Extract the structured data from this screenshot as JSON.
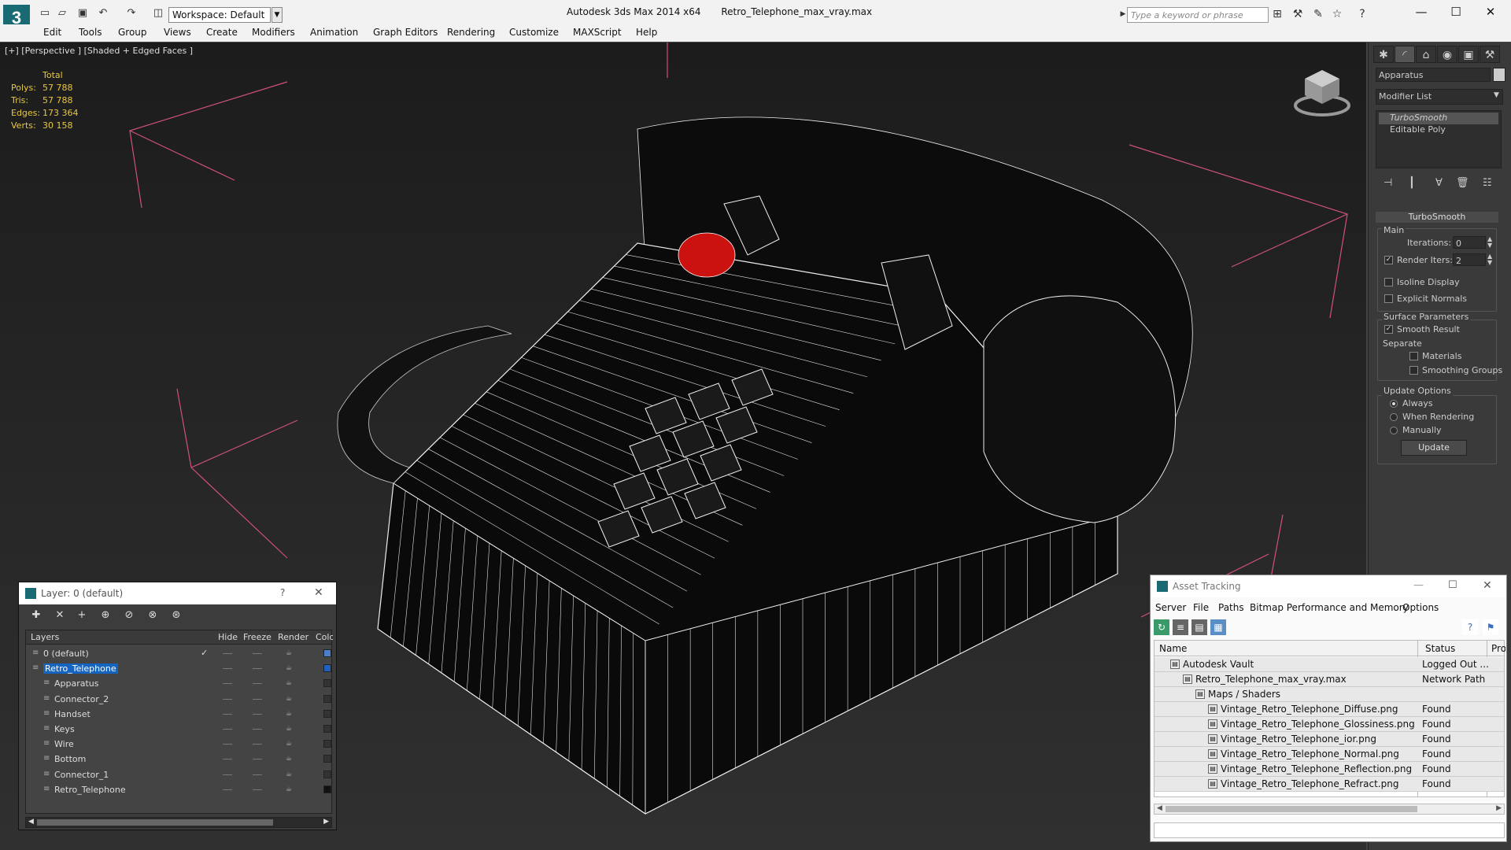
{
  "app": {
    "title": "Autodesk 3ds Max  2014 x64",
    "file": "Retro_Telephone_max_vray.max",
    "logo": "3",
    "workspace": "Workspace: Default",
    "search_placeholder": "Type a keyword or phrase"
  },
  "menu": [
    "Edit",
    "Tools",
    "Group",
    "Views",
    "Create",
    "Modifiers",
    "Animation",
    "Graph Editors",
    "Rendering",
    "Customize",
    "MAXScript",
    "Help"
  ],
  "viewport": {
    "label": "[+] [Perspective ] [Shaded + Edged Faces ]",
    "stats": {
      "header": "Total",
      "rows": [
        {
          "k": "Polys:",
          "v": "57 788"
        },
        {
          "k": "Tris:",
          "v": "57 788"
        },
        {
          "k": "Edges:",
          "v": "173 364"
        },
        {
          "k": "Verts:",
          "v": "30 158"
        }
      ]
    }
  },
  "command_panel": {
    "object_name": "Apparatus",
    "modifier_list": "Modifier List",
    "stack": [
      "TurboSmooth",
      "Editable Poly"
    ],
    "rollout_title": "TurboSmooth",
    "main_label": "Main",
    "iterations_label": "Iterations:",
    "iterations_value": "0",
    "render_iters_label": "Render Iters:",
    "render_iters_value": "2",
    "isoline_label": "Isoline Display",
    "explicit_normals_label": "Explicit Normals",
    "surface_params_label": "Surface Parameters",
    "smooth_result_label": "Smooth Result",
    "separate_label": "Separate",
    "materials_label": "Materials",
    "smoothing_groups_label": "Smoothing Groups",
    "update_options_label": "Update Options",
    "always_label": "Always",
    "when_rendering_label": "When Rendering",
    "manually_label": "Manually",
    "update_button": "Update"
  },
  "layer_window": {
    "title": "Layer: 0 (default)",
    "help": "?",
    "close": "✕",
    "columns": [
      "Layers",
      "Hide",
      "Freeze",
      "Render",
      "Color"
    ],
    "rows": [
      {
        "name": "0 (default)",
        "indent": 0,
        "check": "✓",
        "color": "#4a7fd0"
      },
      {
        "name": "Retro_Telephone",
        "indent": 0,
        "selected": true,
        "color": "#2060c0"
      },
      {
        "name": "Apparatus",
        "indent": 1,
        "color": "#333333"
      },
      {
        "name": "Connector_2",
        "indent": 1,
        "color": "#333333"
      },
      {
        "name": "Handset",
        "indent": 1,
        "color": "#333333"
      },
      {
        "name": "Keys",
        "indent": 1,
        "color": "#333333"
      },
      {
        "name": "Wire",
        "indent": 1,
        "color": "#333333"
      },
      {
        "name": "Bottom",
        "indent": 1,
        "color": "#333333"
      },
      {
        "name": "Connector_1",
        "indent": 1,
        "color": "#333333"
      },
      {
        "name": "Retro_Telephone",
        "indent": 1,
        "color": "#111111"
      }
    ]
  },
  "asset_window": {
    "title": "Asset Tracking",
    "menu": [
      "Server",
      "File",
      "Paths",
      "Bitmap Performance and Memory",
      "Options"
    ],
    "columns": [
      "Name",
      "Status",
      "Pro"
    ],
    "rows": [
      {
        "name": "Autodesk Vault",
        "status": "Logged Out ...",
        "indent": 0
      },
      {
        "name": "Retro_Telephone_max_vray.max",
        "status": "Network Path",
        "indent": 1
      },
      {
        "name": "Maps / Shaders",
        "status": "",
        "indent": 2
      },
      {
        "name": "Vintage_Retro_Telephone_Diffuse.png",
        "status": "Found",
        "indent": 3
      },
      {
        "name": "Vintage_Retro_Telephone_Glossiness.png",
        "status": "Found",
        "indent": 3
      },
      {
        "name": "Vintage_Retro_Telephone_ior.png",
        "status": "Found",
        "indent": 3
      },
      {
        "name": "Vintage_Retro_Telephone_Normal.png",
        "status": "Found",
        "indent": 3
      },
      {
        "name": "Vintage_Retro_Telephone_Reflection.png",
        "status": "Found",
        "indent": 3
      },
      {
        "name": "Vintage_Retro_Telephone_Refract.png",
        "status": "Found",
        "indent": 3
      }
    ]
  },
  "colors": {
    "accent": "#1565c0",
    "stats": "#e8c840",
    "viewport_bg": "#2a2a2a",
    "model_red": "#cc1111"
  }
}
